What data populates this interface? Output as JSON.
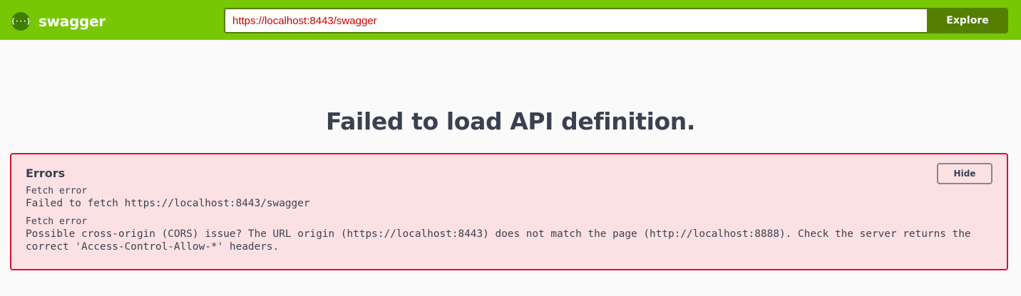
{
  "topbar": {
    "brand": "swagger",
    "logo_glyph": "{···}",
    "url_value": "https://localhost:8443/swagger",
    "explore_label": "Explore"
  },
  "main": {
    "title": "Failed to load API definition."
  },
  "errors": {
    "heading": "Errors",
    "hide_label": "Hide",
    "items": [
      {
        "source": "Fetch error",
        "message": "Failed to fetch https://localhost:8443/swagger"
      },
      {
        "source": "Fetch error",
        "message": "Possible cross-origin (CORS) issue? The URL origin (https://localhost:8443) does not match the page (http://localhost:8888). Check the server returns the correct 'Access-Control-Allow-*' headers."
      }
    ]
  },
  "colors": {
    "topbar_bg": "#77c705",
    "explore_bg": "#547f00",
    "url_text": "#cc0000",
    "error_border": "#dd0e2e",
    "error_bg": "#fce1e4",
    "text_dark": "#3b4151"
  }
}
